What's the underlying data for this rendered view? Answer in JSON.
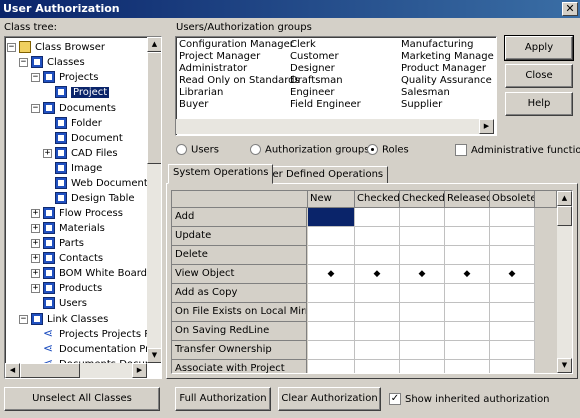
{
  "window": {
    "title": "User Authorization",
    "close_glyph": "✕"
  },
  "tree": {
    "label": "Class tree:",
    "items": [
      {
        "label": "Class Browser"
      },
      {
        "label": "Classes"
      },
      {
        "label": "Projects"
      },
      {
        "label": "Project"
      },
      {
        "label": "Documents"
      },
      {
        "label": "Folder"
      },
      {
        "label": "Document"
      },
      {
        "label": "CAD Files"
      },
      {
        "label": "Image"
      },
      {
        "label": "Web Document"
      },
      {
        "label": "Design Table"
      },
      {
        "label": "Flow Process"
      },
      {
        "label": "Materials"
      },
      {
        "label": "Parts"
      },
      {
        "label": "Contacts"
      },
      {
        "label": "BOM White Board"
      },
      {
        "label": "Products"
      },
      {
        "label": "Users"
      },
      {
        "label": "Link Classes"
      },
      {
        "label": "Projects Projects Re"
      },
      {
        "label": "Documentation Proj"
      },
      {
        "label": "Documents Docume"
      }
    ]
  },
  "groups": {
    "label": "Users/Authorization groups",
    "col1": [
      "Configuration Manager",
      "Project Manager",
      "Administrator",
      "Read Only on Standards",
      "Librarian",
      "Buyer"
    ],
    "col2": [
      "Clerk",
      "Customer",
      "Designer",
      "Draftsman",
      "Engineer",
      "Field Engineer"
    ],
    "col3": [
      "Manufacturing",
      "Marketing Manager",
      "Product Manager",
      "Quality Assurance",
      "Salesman",
      "Supplier"
    ]
  },
  "buttons": {
    "apply": "Apply",
    "close": "Close",
    "help": "Help"
  },
  "mode": {
    "users": "Users",
    "auth_groups": "Authorization groups",
    "roles": "Roles",
    "selected": "Roles",
    "admin_functions": "Administrative functions"
  },
  "tabs": {
    "system": "System Operations",
    "user_defined": "User Defined Operations",
    "active": "System Operations"
  },
  "grid": {
    "columns": [
      "New",
      "Checked I",
      "Checked (",
      "Released",
      "Obsolete"
    ],
    "rows": [
      {
        "label": "Add",
        "marks": [
          "",
          "",
          "",
          "",
          ""
        ]
      },
      {
        "label": "Update",
        "marks": [
          "",
          "",
          "",
          "",
          ""
        ]
      },
      {
        "label": "Delete",
        "marks": [
          "",
          "",
          "",
          "",
          ""
        ]
      },
      {
        "label": "View Object",
        "marks": [
          "◆",
          "◆",
          "◆",
          "◆",
          "◆"
        ]
      },
      {
        "label": "Add as Copy",
        "marks": [
          "",
          "",
          "",
          "",
          ""
        ]
      },
      {
        "label": "On File Exists on Local Mirror",
        "marks": [
          "",
          "",
          "",
          "",
          ""
        ]
      },
      {
        "label": "On Saving RedLine",
        "marks": [
          "",
          "",
          "",
          "",
          ""
        ]
      },
      {
        "label": "Transfer Ownership",
        "marks": [
          "",
          "",
          "",
          "",
          ""
        ]
      },
      {
        "label": "Associate with Project",
        "marks": [
          "",
          "",
          "",
          "",
          ""
        ]
      }
    ]
  },
  "bottom": {
    "unselect": "Unselect All Classes",
    "full": "Full Authorization",
    "clear": "Clear Authorization",
    "show_inherited": "Show inherited authorization",
    "show_inherited_checked": true
  },
  "glyphs": {
    "up": "▲",
    "down": "▼",
    "left": "◀",
    "right": "▶",
    "check": "✓",
    "plus": "+",
    "minus": "−"
  }
}
